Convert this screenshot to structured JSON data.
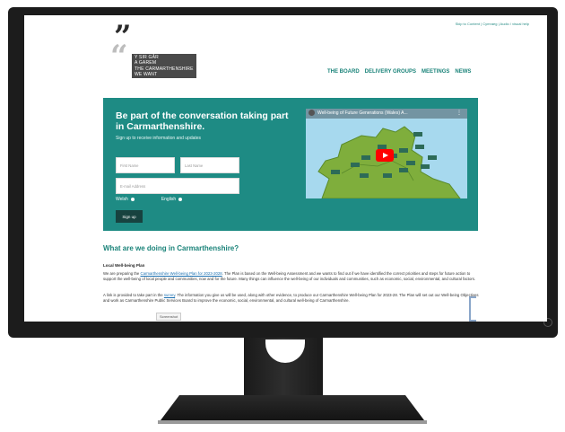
{
  "util_links": "Skip to Content | Cymraeg | Audio / visual help",
  "logo": {
    "line1": "Y SIR GÂR",
    "line2": "A GAREM",
    "line3": "THE CARMARTHENSHIRE",
    "line4": "WE WANT"
  },
  "nav": [
    "THE BOARD",
    "DELIVERY GROUPS",
    "MEETINGS",
    "NEWS"
  ],
  "hero": {
    "title": "Be part of the conversation taking part in Carmarthenshire.",
    "subtitle": "Sign up to receive information and updates",
    "first_name_placeholder": "First Name",
    "last_name_placeholder": "Last Name",
    "email_placeholder": "E-mail Address",
    "welsh_label": "Welsh",
    "english_label": "English",
    "signup_label": "Sign up",
    "video_title": "Well-being of Future Generations (Wales) A..."
  },
  "content": {
    "heading": "What are we doing in Carmarthenshire?",
    "subheading": "Local Well-being Plan",
    "p1_before": "We are preparing the ",
    "p1_link": "Carmarthenshire Well-being Plan for 2023-2028",
    "p1_after": ". The Plan is based on the Well-being Assessment and we wants to find out if we have identified the correct priorities and steps for future action to support the well-being of local people and communities, now and for the future. Many things can influence the well-being of our individuals and communities, such as economic, social, environmental, and cultural factors.",
    "p2_before": "A link is provided to take part in the ",
    "p2_link": "survey",
    "p2_after": ". The information you give us will be used, along with other evidence, to produce our Carmarthenshire Well-being Plan for 2023-28. The Plan will set out our Well-being Objectives and work as Carmarthenshire Public Services Board to improve the economic, social, environmental, and cultural well-being of Carmarthenshire.",
    "screenshot_label": "Screenshot"
  },
  "colors": {
    "accent": "#1e8b84",
    "button": "#17423f"
  }
}
